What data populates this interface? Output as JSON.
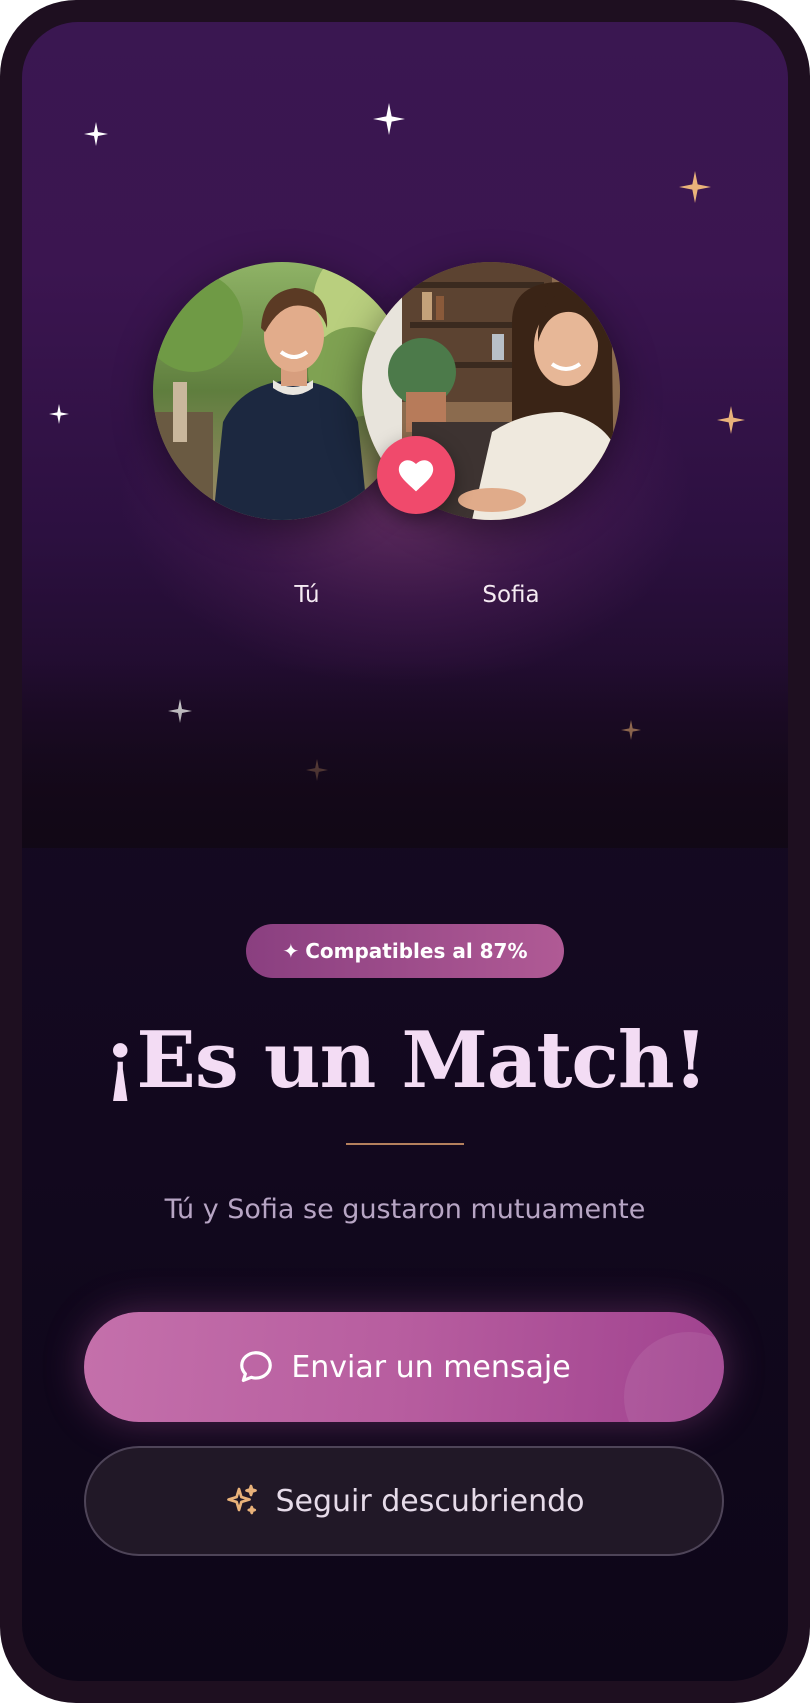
{
  "match": {
    "you_label": "Tú",
    "match_label": "Sofia",
    "badge": {
      "icon": "sparkle-icon",
      "text": "Compatibles al 87%",
      "compatibility_percent": 87
    },
    "title": "¡Es un Match!",
    "subtitle": "Tú y Sofia se gustaron mutuamente"
  },
  "actions": {
    "send_message": {
      "label": "Enviar un mensaje",
      "icon": "chat-bubble-icon"
    },
    "keep_discovering": {
      "label": "Seguir descubriendo",
      "icon": "sparkles-icon"
    }
  },
  "colors": {
    "heart_badge": "#f04a6c",
    "primary_button": "#b75d9f",
    "title": "#f3dcf4",
    "accent_gold": "#e9b27a"
  }
}
